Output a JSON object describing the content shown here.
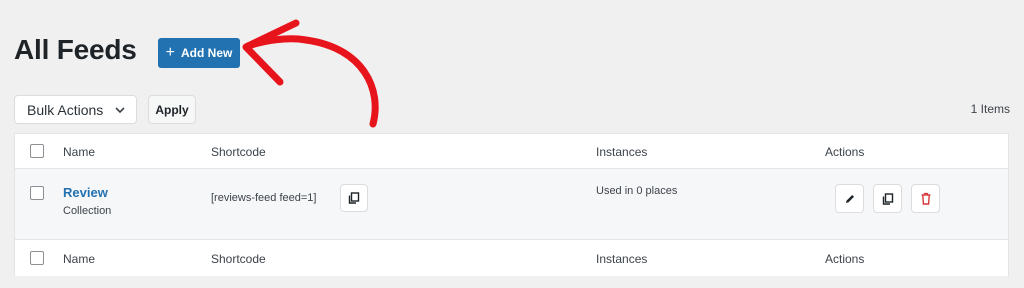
{
  "page": {
    "title": "All Feeds"
  },
  "toolbar": {
    "add_new_label": "Add New",
    "bulk_actions_value": "Bulk Actions",
    "apply_label": "Apply",
    "items_count": "1 Items"
  },
  "table": {
    "columns": [
      "Name",
      "Shortcode",
      "Instances",
      "Actions"
    ],
    "rows": [
      {
        "name": "Review",
        "type": "Collection",
        "shortcode": "[reviews-feed feed=1]",
        "instances": "Used in 0 places"
      }
    ]
  },
  "icons": {
    "plus": "plus-icon",
    "chevron": "chevron-down-icon",
    "copy": "copy-icon",
    "edit": "pencil-icon",
    "duplicate": "duplicate-icon",
    "delete": "trash-icon"
  },
  "colors": {
    "primary": "#2271b1",
    "annotation_arrow": "#e8141b",
    "delete": "#d63638"
  }
}
